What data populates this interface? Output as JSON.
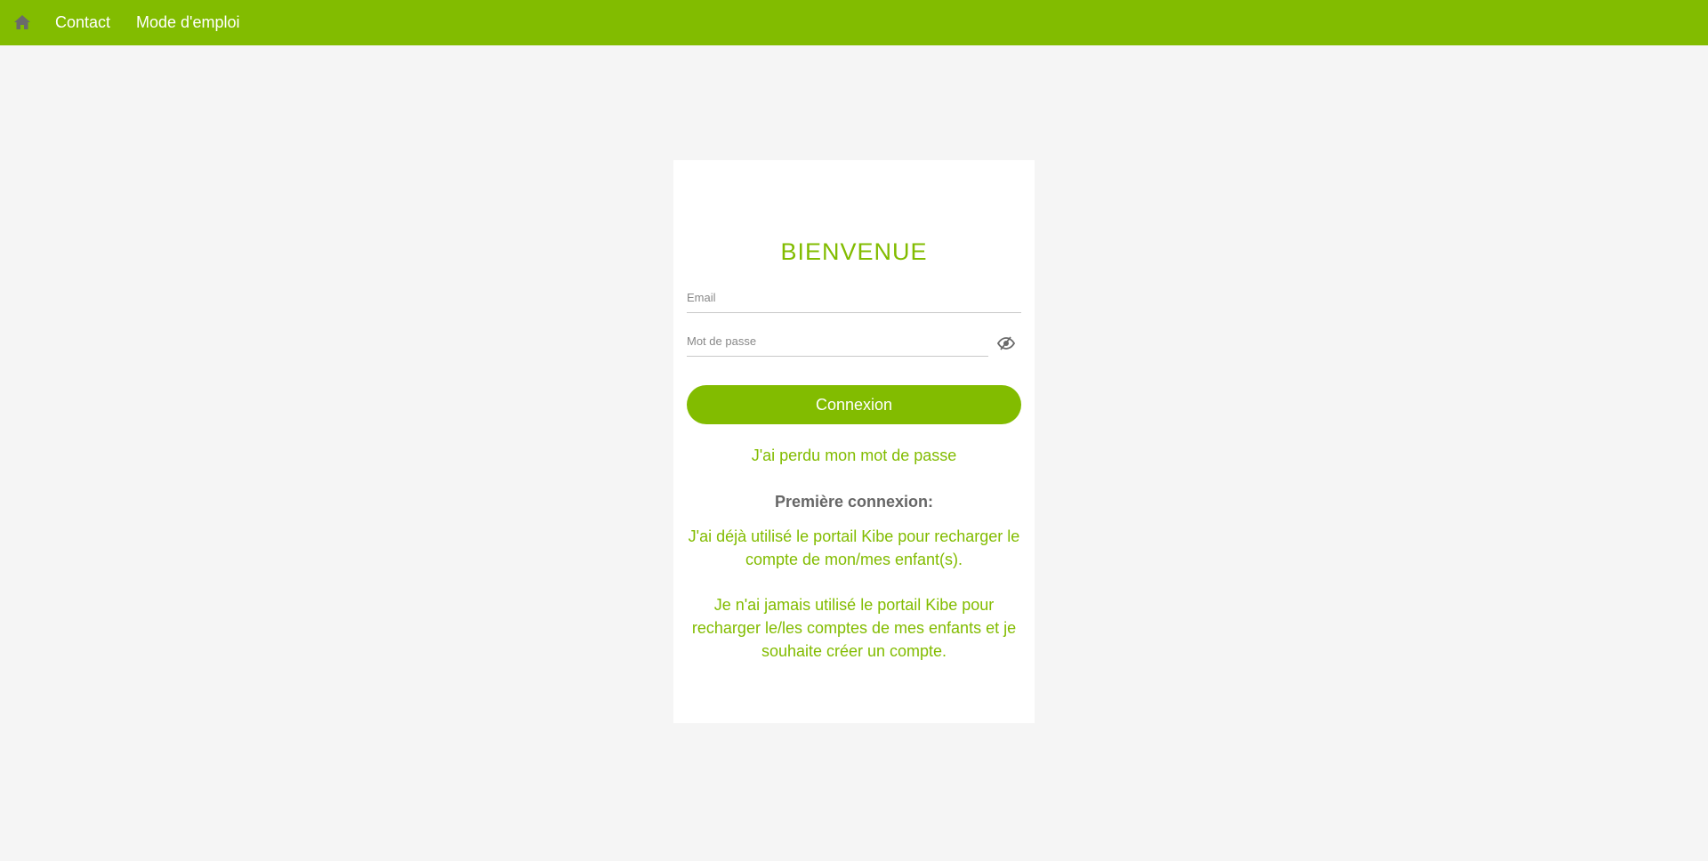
{
  "nav": {
    "home_icon": "home-icon",
    "links": [
      {
        "label": "Contact"
      },
      {
        "label": "Mode d'emploi"
      }
    ]
  },
  "login": {
    "title": "BIENVENUE",
    "email_placeholder": "Email",
    "password_placeholder": "Mot de passe",
    "toggle_icon": "eye-slash-icon",
    "submit_label": "Connexion",
    "lost_password": "J'ai perdu mon mot de passe",
    "first_connection_label": "Première connexion:",
    "existing_user_link": "J'ai déjà utilisé le portail Kibe pour recharger le compte de mon/mes enfant(s).",
    "new_user_link": "Je n'ai jamais utilisé le portail Kibe pour recharger le/les comptes de mes enfants et je souhaite créer un compte."
  },
  "colors": {
    "brand": "#82bc00",
    "background": "#f5f5f5",
    "card": "#ffffff",
    "muted_text": "#666666"
  }
}
